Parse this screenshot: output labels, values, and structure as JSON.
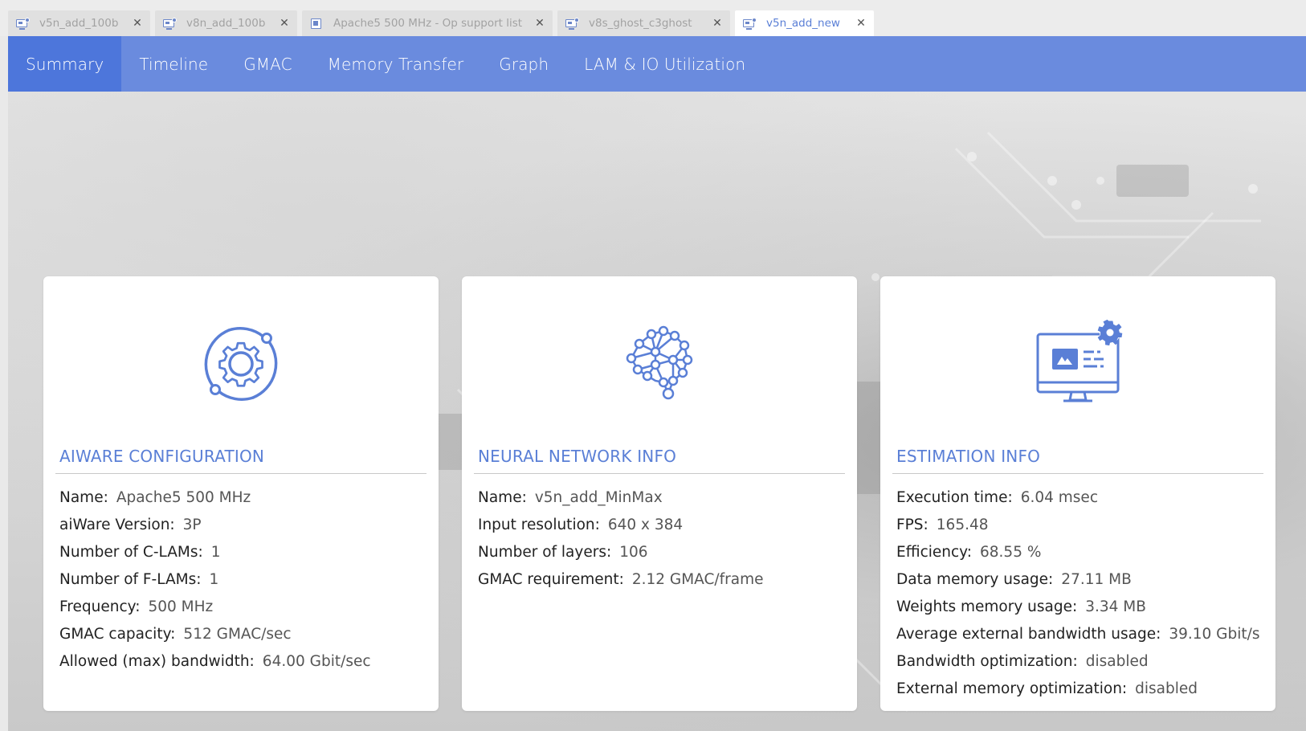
{
  "editor_tabs": [
    {
      "label": "v5n_add_100b",
      "icon": "monitor-icon",
      "active": false
    },
    {
      "label": "v8n_add_100b",
      "icon": "monitor-icon",
      "active": false
    },
    {
      "label": "Apache5 500 MHz - Op support list",
      "icon": "chip-icon",
      "active": false
    },
    {
      "label": "v8s_ghost_c3ghost",
      "icon": "monitor-icon",
      "active": false
    },
    {
      "label": "v5n_add_new",
      "icon": "monitor-icon",
      "active": true
    }
  ],
  "nav": {
    "items": [
      "Summary",
      "Timeline",
      "GMAC",
      "Memory Transfer",
      "Graph",
      "LAM & IO Utilization"
    ],
    "active": "Summary"
  },
  "colors": {
    "accent": "#6a8bde",
    "accent_active": "#4d76db",
    "title_blue": "#5a7fd6"
  },
  "cards": {
    "aiware": {
      "title": "AIWARE CONFIGURATION",
      "icon": "gear-cycle-icon",
      "rows": [
        {
          "key": "Name:",
          "value": "Apache5 500 MHz"
        },
        {
          "key": "aiWare Version:",
          "value": "3P"
        },
        {
          "key": "Number of C-LAMs:",
          "value": "1"
        },
        {
          "key": "Number of F-LAMs:",
          "value": "1"
        },
        {
          "key": "Frequency:",
          "value": "500 MHz"
        },
        {
          "key": "GMAC capacity:",
          "value": "512 GMAC/sec"
        },
        {
          "key": "Allowed (max) bandwidth:",
          "value": "64.00 Gbit/sec"
        }
      ]
    },
    "network": {
      "title": "NEURAL NETWORK INFO",
      "icon": "neural-brain-icon",
      "rows": [
        {
          "key": "Name:",
          "value": "v5n_add_MinMax"
        },
        {
          "key": "Input resolution:",
          "value": "640 x 384"
        },
        {
          "key": "Number of layers:",
          "value": "106"
        },
        {
          "key": "GMAC requirement:",
          "value": "2.12 GMAC/frame"
        }
      ]
    },
    "estimation": {
      "title": "ESTIMATION INFO",
      "icon": "monitor-settings-icon",
      "rows": [
        {
          "key": "Execution time:",
          "value": "6.04 msec"
        },
        {
          "key": "FPS:",
          "value": "165.48"
        },
        {
          "key": "Efficiency:",
          "value": "68.55 %"
        },
        {
          "key": "Data memory usage:",
          "value": "27.11 MB"
        },
        {
          "key": "Weights memory usage:",
          "value": "3.34 MB"
        },
        {
          "key": "Average external bandwidth usage:",
          "value": "39.10 Gbit/s"
        },
        {
          "key": "Bandwidth optimization:",
          "value": "disabled"
        },
        {
          "key": "External memory optimization:",
          "value": "disabled"
        }
      ]
    }
  }
}
